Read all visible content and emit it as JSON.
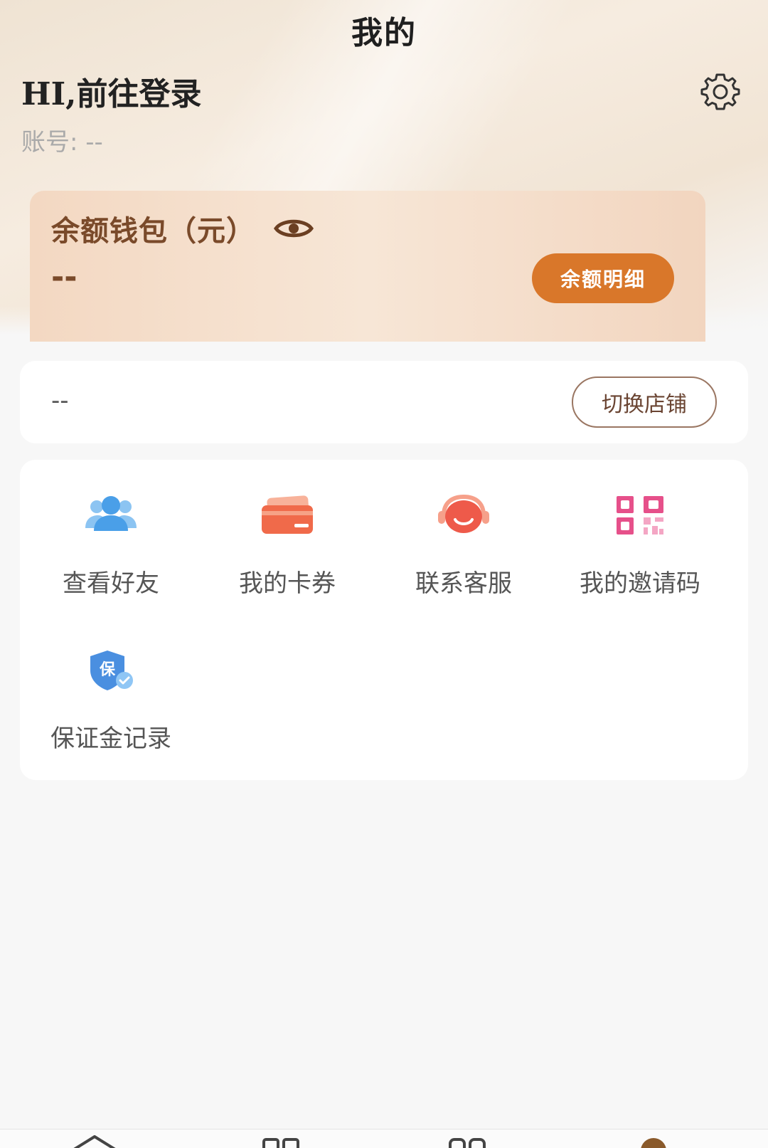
{
  "header": {
    "title": "我的",
    "greeting": "HI,前往登录",
    "account": "账号: --",
    "settings_icon": "gear-icon"
  },
  "wallet": {
    "title": "余额钱包（元）",
    "value": "--",
    "detail_button": "余额明细",
    "eye_icon": "eye-icon"
  },
  "store": {
    "name": "--",
    "switch_button": "切换店铺"
  },
  "menu": {
    "items": [
      {
        "label": "查看好友",
        "icon": "friends-icon"
      },
      {
        "label": "我的卡券",
        "icon": "card-icon"
      },
      {
        "label": "联系客服",
        "icon": "customer-service-icon"
      },
      {
        "label": "我的邀请码",
        "icon": "qr-code-icon"
      },
      {
        "label": "保证金记录",
        "icon": "shield-icon"
      }
    ]
  },
  "tabbar": {
    "icons": [
      "home-icon",
      "grid-icon",
      "category-icon",
      "profile-icon"
    ]
  },
  "colors": {
    "accent": "#d9772a",
    "wallet_text": "#7a4a2a",
    "friends": "#4a9fe8",
    "card": "#f06a4a",
    "service": "#ee5a4a",
    "qr": "#e6508a",
    "shield": "#4a8fe0"
  }
}
